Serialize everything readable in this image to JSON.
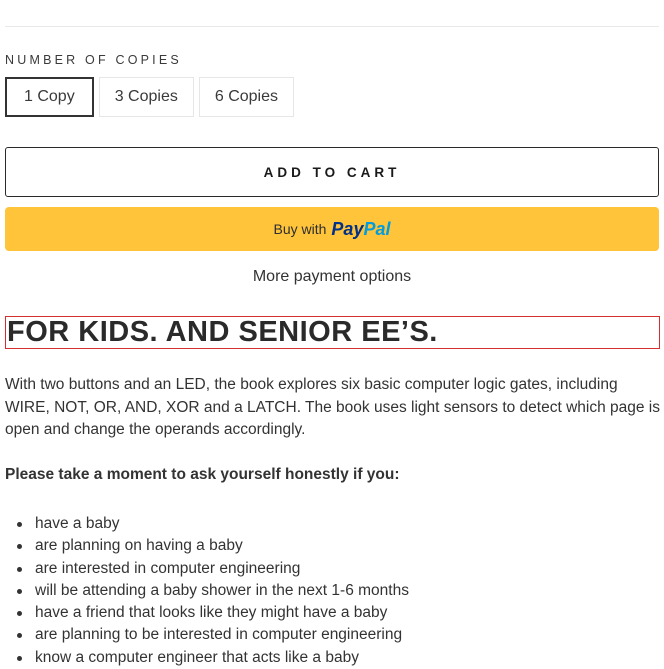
{
  "copies": {
    "label": "NUMBER OF COPIES",
    "options": [
      {
        "label": "1 Copy",
        "selected": true
      },
      {
        "label": "3 Copies",
        "selected": false
      },
      {
        "label": "6 Copies",
        "selected": false
      }
    ]
  },
  "cart": {
    "add_label": "ADD TO CART"
  },
  "paypal": {
    "buy_with": "Buy with",
    "brand_pay": "Pay",
    "brand_pal": "Pal"
  },
  "more_payment": "More payment options",
  "product": {
    "heading": "FOR KIDS. AND SENIOR EE’S.",
    "description": "With two buttons and an LED, the book explores six basic computer logic gates, including WIRE, NOT, OR, AND, XOR and a LATCH. The book uses light sensors to detect which page is open and change the operands accordingly.",
    "question": "Please take a moment to ask yourself honestly if you:",
    "bullets": [
      "have a baby",
      "are planning on having a baby",
      "are interested in computer engineering",
      "will be attending a baby shower in the next 1-6 months",
      "have a friend that looks like they might have a baby",
      "are planning to be interested in computer engineering",
      "know a computer engineer that acts like a baby"
    ]
  },
  "colors": {
    "paypal_yellow": "#ffc439",
    "paypal_blue_dark": "#003087",
    "paypal_blue_light": "#009cde",
    "focus_outline": "#d32f2f"
  }
}
